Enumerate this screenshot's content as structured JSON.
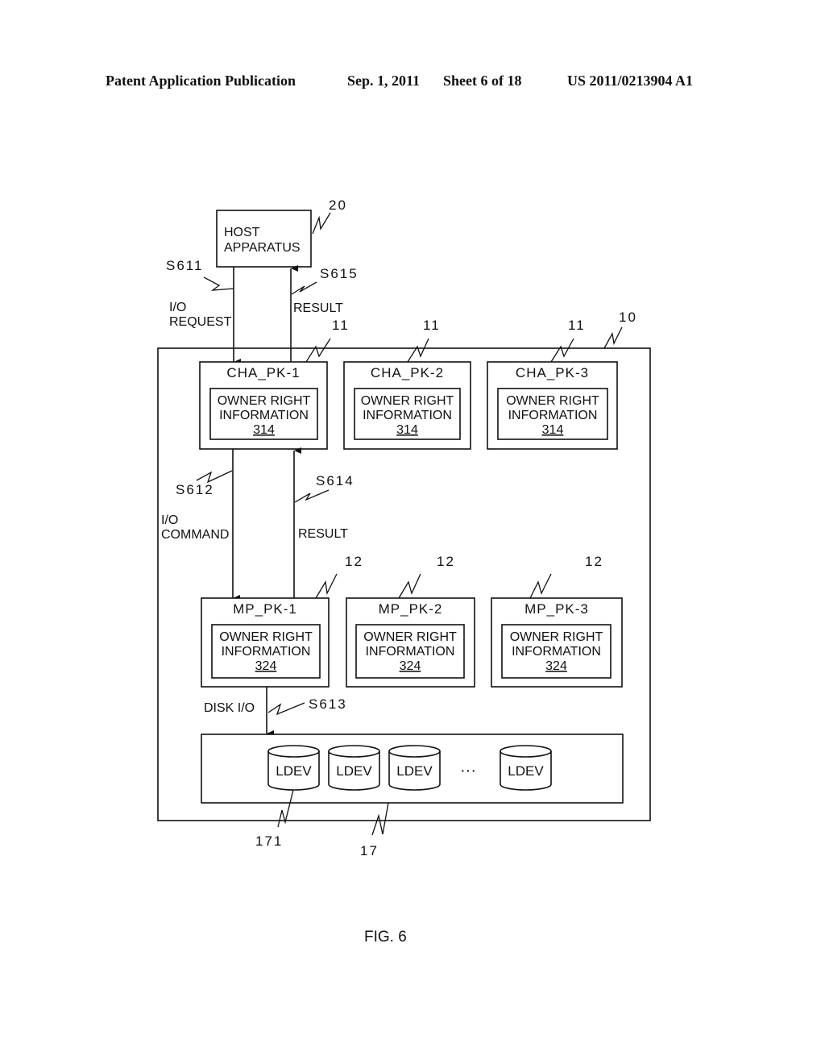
{
  "header": {
    "publication": "Patent Application Publication",
    "date": "Sep. 1, 2011",
    "sheet": "Sheet 6 of 18",
    "number": "US 2011/0213904 A1"
  },
  "figure": {
    "caption": "FIG. 6",
    "host": {
      "line1": "HOST",
      "line2": "APPARATUS",
      "ref": "20"
    },
    "storage_system_ref": "10",
    "cha_packages": [
      {
        "name": "CHA_PK-1",
        "ref": "11",
        "info_line1": "OWNER RIGHT",
        "info_line2": "INFORMATION",
        "info_ref": "314"
      },
      {
        "name": "CHA_PK-2",
        "ref": "11",
        "info_line1": "OWNER RIGHT",
        "info_line2": "INFORMATION",
        "info_ref": "314"
      },
      {
        "name": "CHA_PK-3",
        "ref": "11",
        "info_line1": "OWNER RIGHT",
        "info_line2": "INFORMATION",
        "info_ref": "314"
      }
    ],
    "mp_packages": [
      {
        "name": "MP_PK-1",
        "ref": "12",
        "info_line1": "OWNER RIGHT",
        "info_line2": "INFORMATION",
        "info_ref": "324"
      },
      {
        "name": "MP_PK-2",
        "ref": "12",
        "info_line1": "OWNER RIGHT",
        "info_line2": "INFORMATION",
        "info_ref": "324"
      },
      {
        "name": "MP_PK-3",
        "ref": "12",
        "info_line1": "OWNER RIGHT",
        "info_line2": "INFORMATION",
        "info_ref": "324"
      }
    ],
    "steps": {
      "s611": {
        "id": "S611",
        "line1": "I/O",
        "line2": "REQUEST"
      },
      "s615": {
        "id": "S615",
        "label": "RESULT"
      },
      "s612": {
        "id": "S612",
        "line1": "I/O",
        "line2": "COMMAND"
      },
      "s614": {
        "id": "S614",
        "label": "RESULT"
      },
      "s613": {
        "id": "S613",
        "label": "DISK I/O"
      }
    },
    "disk_unit": {
      "ref": "17",
      "ldev_ref": "171",
      "ldevs": [
        "LDEV",
        "LDEV",
        "LDEV",
        "LDEV"
      ],
      "ellipsis": "···"
    }
  }
}
